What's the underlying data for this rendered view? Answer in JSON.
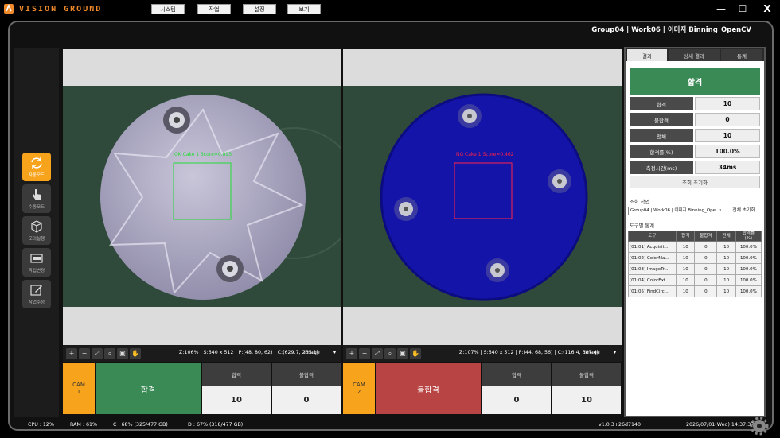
{
  "app": {
    "logo_text": "VISION GROUND",
    "window_title": "Group04 | Work06 | 이미지 Binning_OpenCV"
  },
  "menu": [
    {
      "label": "시스템"
    },
    {
      "label": "작업"
    },
    {
      "label": "설정"
    },
    {
      "label": "보기"
    }
  ],
  "window_buttons": {
    "minimize": "—",
    "maximize": "☐",
    "close": "X"
  },
  "sidebar": [
    {
      "label": "자동모드",
      "icon": "sync-icon",
      "active": true
    },
    {
      "label": "수동모드",
      "icon": "hand-pointer-icon",
      "active": false
    },
    {
      "label": "모의실행",
      "icon": "cube-icon",
      "active": false
    },
    {
      "label": "작업변경",
      "icon": "swap-icon",
      "active": false
    },
    {
      "label": "작업수정",
      "icon": "edit-icon",
      "active": false
    }
  ],
  "cam1": {
    "roi_label": "OK Cake 1 Score=0.893",
    "status": "Z:106% | S:640 x 512 | P:(48, 80, 62) | C:(629.7, 255.1)",
    "image_select": "Image",
    "badge": "CAM\n1",
    "verdict": "합격",
    "pass_label": "합격",
    "fail_label": "불합격",
    "pass_count": "10",
    "fail_count": "0",
    "verdict_color": "#3a8a55"
  },
  "cam2": {
    "roi_label": "NG Cake 1 Score=0.462",
    "status": "Z:107% | S:640 x 512 | P:(44, 68, 56) | C:(116.4, 387.4)",
    "image_select": "Image",
    "badge": "CAM\n2",
    "verdict": "불합격",
    "pass_label": "합격",
    "fail_label": "불합격",
    "pass_count": "0",
    "fail_count": "10",
    "verdict_color": "#b94444"
  },
  "tools": [
    "zoom-in-icon",
    "zoom-out-icon",
    "fit-icon",
    "zoom-area-icon",
    "actual-size-icon",
    "pan-hand-icon"
  ],
  "right_panel": {
    "tabs": [
      {
        "label": "결과"
      },
      {
        "label": "상세 결과"
      },
      {
        "label": "통계"
      }
    ],
    "overall": "합격",
    "stats": [
      {
        "k": "합격",
        "v": "10"
      },
      {
        "k": "불합격",
        "v": "0"
      },
      {
        "k": "전체",
        "v": "10"
      },
      {
        "k": "합격률(%)",
        "v": "100.0%"
      },
      {
        "k": "측정시간(ms)",
        "v": "34ms"
      }
    ],
    "reset_label": "조회 초기화",
    "query_label": "조회 작업",
    "query_value": "Group04 | Work06 | 이미지 Binning_Ope",
    "all_reset_label": "전체 초기화",
    "tool_stats_label": "도구별 통계",
    "table": {
      "headers": [
        "도구",
        "합격",
        "불합격",
        "전체",
        "합격률\n(%)"
      ],
      "rows": [
        [
          "[01:01] Acquisiti...",
          "10",
          "0",
          "10",
          "100.0%"
        ],
        [
          "[01:02] ColorMa...",
          "10",
          "0",
          "10",
          "100.0%"
        ],
        [
          "[01:03] ImageTr...",
          "10",
          "0",
          "10",
          "100.0%"
        ],
        [
          "[01:04] ColorExt...",
          "10",
          "0",
          "10",
          "100.0%"
        ],
        [
          "[01:05] FindCircl...",
          "10",
          "0",
          "10",
          "100.0%"
        ]
      ]
    }
  },
  "statusbar": {
    "cpu": "CPU : 12%",
    "ram": "RAM : 61%",
    "disk_c": "C : 68% (325/477 GB)",
    "disk_d": "D : 67% (318/477 GB)",
    "version": "v1.0.3+26d7140",
    "datetime": "2026/07/01(Wed) 14:37:37"
  },
  "colors": {
    "accent": "#f7a31c",
    "pass": "#3a8a55",
    "fail": "#b94444",
    "roi_ok": "#22dd33",
    "roi_ng": "#ff2244",
    "logo": "#f08a2b"
  }
}
